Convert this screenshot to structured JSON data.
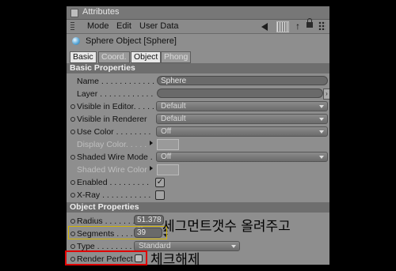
{
  "window": {
    "title": "Attributes"
  },
  "menu": {
    "mode": "Mode",
    "edit": "Edit",
    "user_data": "User Data"
  },
  "object": {
    "title": "Sphere Object [Sphere]"
  },
  "tabs": [
    {
      "label": "Basic",
      "active": true
    },
    {
      "label": "Coord.",
      "active": false
    },
    {
      "label": "Object",
      "active": true
    },
    {
      "label": "Phong",
      "active": false
    }
  ],
  "basic": {
    "header": "Basic Properties",
    "name": {
      "label": "Name . . . . . . . . . . . .",
      "value": "Sphere"
    },
    "layer": {
      "label": "Layer . . . . . . . . . . . ."
    },
    "visible_editor": {
      "label": "Visible in Editor. . . . .",
      "value": "Default"
    },
    "visible_renderer": {
      "label": "Visible in Renderer",
      "value": "Default"
    },
    "use_color": {
      "label": "Use Color . . . . . . . .",
      "value": "Off"
    },
    "display_color": {
      "label": "Display Color. . . . ."
    },
    "shaded_wire_mode": {
      "label": "Shaded Wire Mode .",
      "value": "Off"
    },
    "shaded_wire_color": {
      "label": "Shaded Wire Color"
    },
    "enabled": {
      "label": "Enabled . . . . . . . . .",
      "checked": true
    },
    "xray": {
      "label": "X-Ray . . . . . . . . . . .",
      "checked": false
    }
  },
  "object_props": {
    "header": "Object Properties",
    "radius": {
      "label": "Radius . . . . . . .",
      "value": "51.378 m"
    },
    "segments": {
      "label": "Segments . . . .",
      "value": "39"
    },
    "type": {
      "label": "Type . . . . . . . .",
      "value": "Standard"
    },
    "render_perfect": {
      "label": "Render Perfect",
      "checked": false
    }
  },
  "annotations": {
    "segments_note": "세그먼트갯수 올려주고",
    "render_perfect_note": "체크해제"
  },
  "colors": {
    "highlight_yellow": "#d4b400",
    "highlight_red": "#e00000",
    "panel": "#8e8e8e",
    "section": "#6e6e6e"
  }
}
